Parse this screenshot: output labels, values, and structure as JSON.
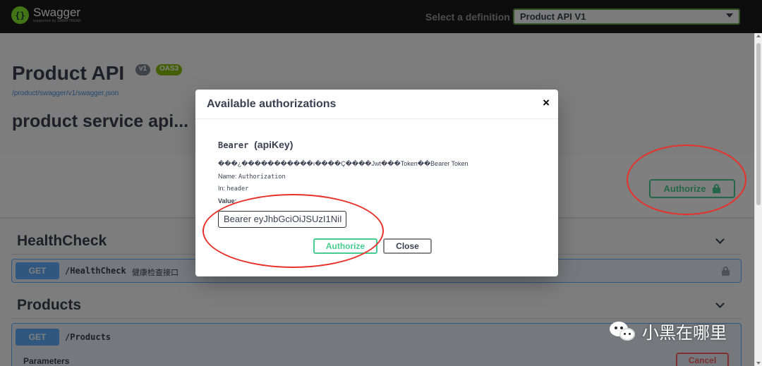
{
  "topbar": {
    "logo_name": "Swagger",
    "logo_sub": "supported by SMARTBEAR",
    "select_label": "Select a definition",
    "select_value": "Product API V1"
  },
  "info": {
    "title": "Product API",
    "version_badge": "v1",
    "oas_badge": "OAS3",
    "url": "/product/swagger/v1/swagger.json",
    "description": "product service api..."
  },
  "authorize_button": {
    "label": "Authorize"
  },
  "tags": [
    {
      "name": "HealthCheck",
      "operations": [
        {
          "method": "GET",
          "path": "/HealthCheck",
          "summary": "健康检查接口"
        }
      ]
    },
    {
      "name": "Products",
      "operations": [
        {
          "method": "GET",
          "path": "/Products",
          "summary": ""
        }
      ]
    }
  ],
  "parameters": {
    "label": "Parameters",
    "cancel_label": "Cancel"
  },
  "modal": {
    "title": "Available authorizations",
    "close_glyph": "×",
    "scheme_name": "Bearer",
    "scheme_type": "(apiKey)",
    "description": "���¿�����������ı����Ç����Jwt���Token��Bearer Token",
    "name_label": "Name:",
    "name_value": "Authorization",
    "in_label": "In:",
    "in_value": "header",
    "value_label": "Value:",
    "value_input": "Bearer eyJhbGciOiJSUzI1NiI",
    "authorize_label": "Authorize",
    "close_label": "Close"
  },
  "watermark": {
    "text": "小黑在哪里"
  },
  "colors": {
    "topbar_bg": "#1b1b1b",
    "accent_green": "#49cc90",
    "get_blue": "#61affe",
    "annotation_red": "#e8312a",
    "cancel_red": "#ff6060"
  },
  "icons": {
    "lock": "lock-icon",
    "chevron": "chevron-down-icon",
    "close": "close-icon",
    "wechat": "wechat-icon"
  }
}
